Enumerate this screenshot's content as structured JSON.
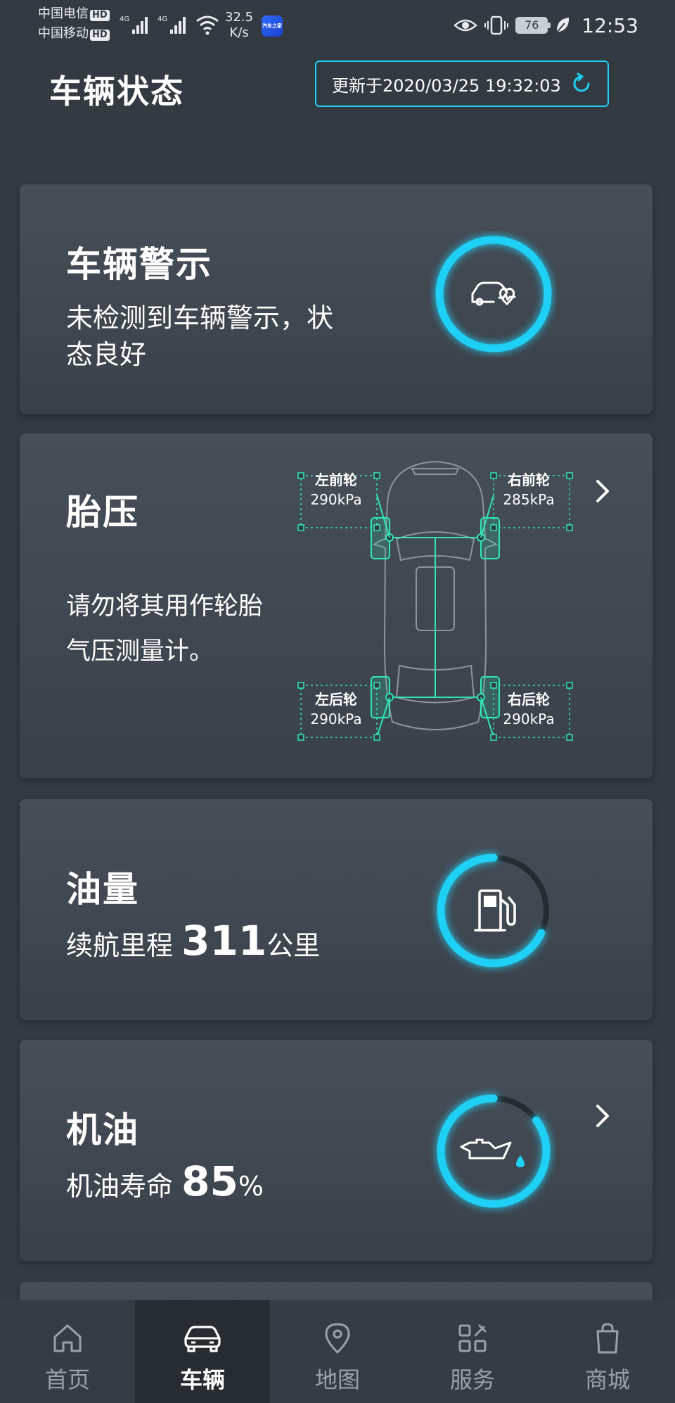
{
  "status_bar": {
    "carrier1": "中国电信",
    "carrier2": "中国移动",
    "hd": "HD",
    "net_type": "4G",
    "net_speed_value": "32.5",
    "net_speed_unit": "K/s",
    "app_badge_text": "汽车之家",
    "battery": "76",
    "time": "12:53"
  },
  "header": {
    "title": "车辆状态",
    "updated": "更新于2020/03/25 19:32:03"
  },
  "warning_card": {
    "title": "车辆警示",
    "desc_line1": "未检测到车辆警示，状",
    "desc_line2": "态良好"
  },
  "tire_card": {
    "title": "胎压",
    "desc_line1": "请勿将其用作轮胎",
    "desc_line2": "气压测量计。",
    "tires": {
      "front_left": {
        "name": "左前轮",
        "value": "290kPa"
      },
      "front_right": {
        "name": "右前轮",
        "value": "285kPa"
      },
      "rear_left": {
        "name": "左后轮",
        "value": "290kPa"
      },
      "rear_right": {
        "name": "右后轮",
        "value": "290kPa"
      }
    }
  },
  "fuel_card": {
    "title": "油量",
    "range_label": "续航里程",
    "range_value": "311",
    "range_unit": "公里",
    "gauge_fraction": 0.68
  },
  "oil_card": {
    "title": "机油",
    "life_label": "机油寿命",
    "life_value": "85",
    "life_unit": "%",
    "gauge_fraction": 0.85
  },
  "bottom_nav": {
    "items": [
      {
        "label": "首页",
        "icon": "home-icon"
      },
      {
        "label": "车辆",
        "icon": "car-icon"
      },
      {
        "label": "地图",
        "icon": "map-pin-icon"
      },
      {
        "label": "服务",
        "icon": "services-icon"
      },
      {
        "label": "商城",
        "icon": "shopping-bag-icon"
      }
    ],
    "active_index": 1
  },
  "colors": {
    "accent": "#1ed0f5",
    "tire_line": "#2ee8b8",
    "background": "#333a42"
  }
}
